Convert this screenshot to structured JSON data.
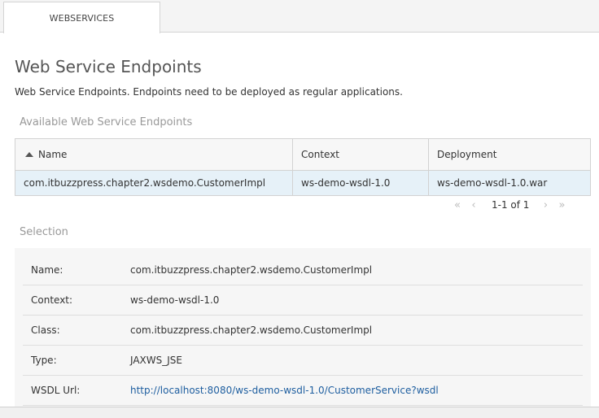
{
  "tabs": [
    {
      "label": "WEBSERVICES"
    }
  ],
  "page": {
    "title": "Web Service Endpoints",
    "description": "Web Service Endpoints. Endpoints need to be deployed as regular applications."
  },
  "available": {
    "heading": "Available Web Service Endpoints",
    "columns": [
      "Name",
      "Context",
      "Deployment"
    ],
    "sort": {
      "column": "Name",
      "direction": "ascending"
    },
    "rows": [
      {
        "name": "com.itbuzzpress.chapter2.wsdemo.CustomerImpl",
        "context": "ws-demo-wsdl-1.0",
        "deployment": "ws-demo-wsdl-1.0.war"
      }
    ],
    "pager": {
      "status": "1-1 of 1"
    }
  },
  "selection": {
    "heading": "Selection",
    "fields": [
      {
        "label": "Name:",
        "value": "com.itbuzzpress.chapter2.wsdemo.CustomerImpl"
      },
      {
        "label": "Context:",
        "value": "ws-demo-wsdl-1.0"
      },
      {
        "label": "Class:",
        "value": "com.itbuzzpress.chapter2.wsdemo.CustomerImpl"
      },
      {
        "label": "Type:",
        "value": "JAXWS_JSE"
      },
      {
        "label": "WSDL Url:",
        "value": "http://localhost:8080/ws-demo-wsdl-1.0/CustomerService?wsdl"
      }
    ]
  },
  "colors": {
    "accent": "#1f5fa0",
    "selected_row": "#e6f1f8",
    "muted_text": "#999999"
  }
}
